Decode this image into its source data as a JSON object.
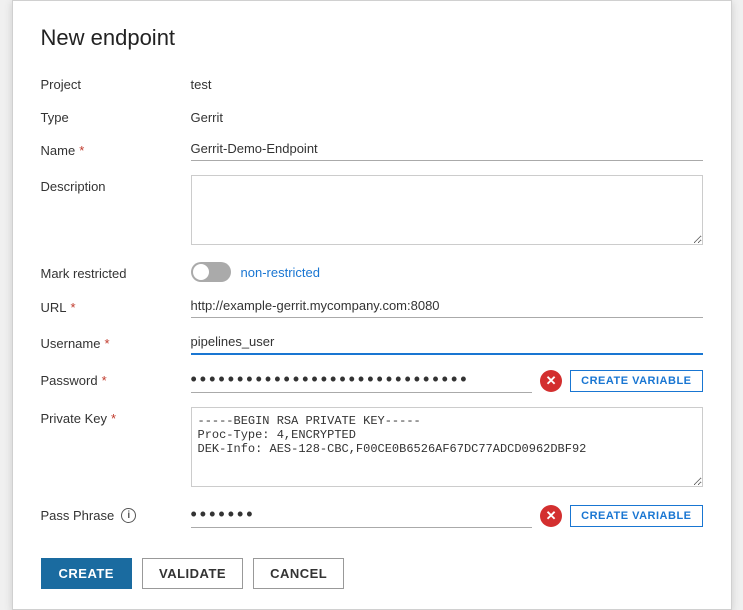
{
  "dialog": {
    "title": "New endpoint"
  },
  "form": {
    "project_label": "Project",
    "project_value": "test",
    "type_label": "Type",
    "type_value": "Gerrit",
    "name_label": "Name",
    "name_placeholder": "Gerrit-Demo-Endpoint",
    "name_value": "Gerrit-Demo-Endpoint",
    "description_label": "Description",
    "description_value": "",
    "mark_restricted_label": "Mark restricted",
    "toggle_status": "non-restricted",
    "url_label": "URL",
    "url_value": "http://example-gerrit.mycompany.com:8080",
    "username_label": "Username",
    "username_value": "pipelines_user",
    "password_label": "Password",
    "password_value": "••••••••••••••••••••••••••••••",
    "private_key_label": "Private Key",
    "private_key_value": "-----BEGIN RSA PRIVATE KEY-----\nProc-Type: 4,ENCRYPTED\nDEK-Info: AES-128-CBC,F00CE0B6526AF67DC77ADCD0962DBF92",
    "pass_phrase_label": "Pass Phrase",
    "pass_phrase_value": "•••••••",
    "create_variable_label": "CREATE VARIABLE"
  },
  "buttons": {
    "create": "CREATE",
    "validate": "VALIDATE",
    "cancel": "CANCEL"
  }
}
